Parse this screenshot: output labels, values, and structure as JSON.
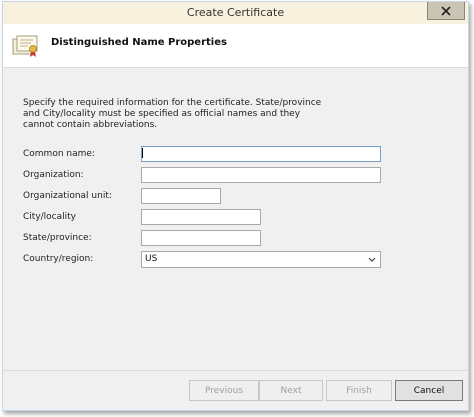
{
  "window": {
    "title": "Create Certificate"
  },
  "header": {
    "title": "Distinguished Name Properties"
  },
  "description": "Specify the required information for the certificate. State/province and City/locality must be specified as official names and they cannot contain abbreviations.",
  "form": {
    "common_name": {
      "label": "Common name:",
      "value": ""
    },
    "organization": {
      "label": "Organization:",
      "value": ""
    },
    "organizational_unit": {
      "label": "Organizational unit:",
      "value": ""
    },
    "city": {
      "label": "City/locality",
      "value": ""
    },
    "state": {
      "label": "State/province:",
      "value": ""
    },
    "country": {
      "label": "Country/region:",
      "value": "US"
    }
  },
  "buttons": {
    "previous": "Previous",
    "next": "Next",
    "finish": "Finish",
    "cancel": "Cancel"
  }
}
